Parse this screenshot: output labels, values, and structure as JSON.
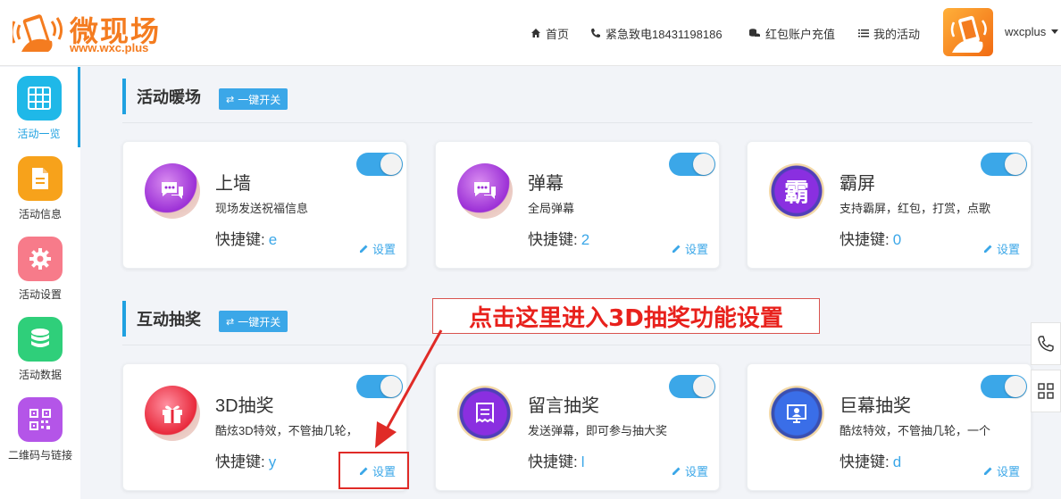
{
  "header": {
    "logo_title": "微现场",
    "logo_url": "www.wxc.plus",
    "nav": [
      {
        "label": "首页",
        "icon": "home-icon"
      },
      {
        "label": "紧急致电18431198186",
        "icon": "phone-icon"
      },
      {
        "label": "红包账户充值",
        "icon": "coins-icon"
      },
      {
        "label": "我的活动",
        "icon": "list-icon"
      }
    ],
    "username": "wxcplus"
  },
  "sidebar": {
    "items": [
      {
        "label": "活动一览",
        "icon": "grid-icon",
        "color": "#1fb8e8",
        "active": true
      },
      {
        "label": "活动信息",
        "icon": "document-icon",
        "color": "#f7a21b",
        "active": false
      },
      {
        "label": "活动设置",
        "icon": "gear-icon",
        "color": "#f77b8a",
        "active": false
      },
      {
        "label": "活动数据",
        "icon": "database-icon",
        "color": "#2fcf7a",
        "active": false
      },
      {
        "label": "二维码与链接",
        "icon": "qrcode-icon",
        "color": "#b455e8",
        "active": false
      }
    ]
  },
  "sections": [
    {
      "title": "活动暖场",
      "toggle_all_label": "一键开关",
      "cards": [
        {
          "title": "上墙",
          "desc": "现场发送祝福信息",
          "key_label": "快捷键:",
          "key": "e",
          "setting_label": "设置",
          "enabled": true
        },
        {
          "title": "弹幕",
          "desc": "全局弹幕",
          "key_label": "快捷键:",
          "key": "2",
          "setting_label": "设置",
          "enabled": true
        },
        {
          "title": "霸屏",
          "desc": "支持霸屏，红包，打赏，点歌",
          "key_label": "快捷键:",
          "key": "0",
          "setting_label": "设置",
          "enabled": true
        }
      ]
    },
    {
      "title": "互动抽奖",
      "toggle_all_label": "一键开关",
      "cards": [
        {
          "title": "3D抽奖",
          "desc": "酷炫3D特效，不管抽几轮，",
          "key_label": "快捷键:",
          "key": "y",
          "setting_label": "设置",
          "enabled": true
        },
        {
          "title": "留言抽奖",
          "desc": "发送弹幕，即可参与抽大奖",
          "key_label": "快捷键:",
          "key": "l",
          "setting_label": "设置",
          "enabled": true
        },
        {
          "title": "巨幕抽奖",
          "desc": "酷炫特效，不管抽几轮，一个",
          "key_label": "快捷键:",
          "key": "d",
          "setting_label": "设置",
          "enabled": true
        }
      ]
    }
  ],
  "annotation": {
    "text": "点击这里进入3D抽奖功能设置",
    "color": "#e8211c"
  },
  "floating": [
    {
      "icon": "phone-icon"
    },
    {
      "icon": "qrcode-icon"
    }
  ],
  "colors": {
    "accent": "#3ba7e8",
    "brand": "#f47c20"
  }
}
